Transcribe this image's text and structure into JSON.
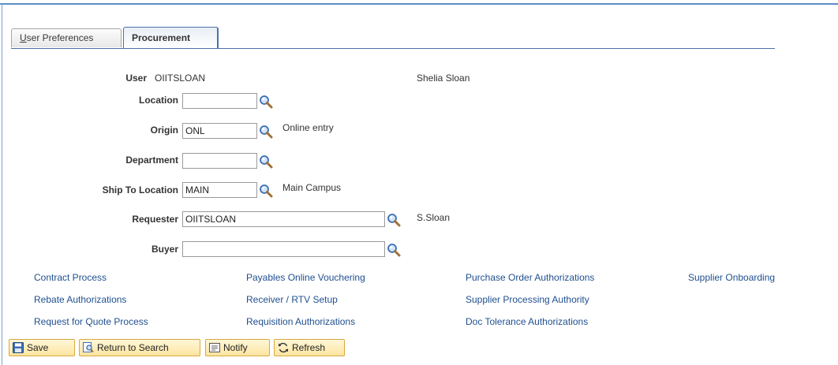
{
  "tabs": [
    {
      "label_accel": "U",
      "label_rest": "ser Preferences",
      "active": false
    },
    {
      "label": "Procurement",
      "active": true
    }
  ],
  "form": {
    "user": {
      "label": "User",
      "value": "OIITSLOAN",
      "description": "Shelia Sloan"
    },
    "location": {
      "label": "Location",
      "value": ""
    },
    "origin": {
      "label": "Origin",
      "value": "ONL",
      "description": "Online entry"
    },
    "department": {
      "label": "Department",
      "value": ""
    },
    "ship_to": {
      "label": "Ship To Location",
      "value": "MAIN",
      "description": "Main Campus"
    },
    "requester": {
      "label": "Requester",
      "value": "OIITSLOAN",
      "description": "S.Sloan"
    },
    "buyer": {
      "label": "Buyer",
      "value": ""
    }
  },
  "links": [
    "Contract Process",
    "Payables Online Vouchering",
    "Purchase Order Authorizations",
    "Supplier Onboarding",
    "Rebate Authorizations",
    "Receiver / RTV Setup",
    "Supplier Processing Authority",
    "Request for Quote Process",
    "Requisition Authorizations",
    "Doc Tolerance Authorizations"
  ],
  "toolbar": {
    "save": "Save",
    "return_to_search": "Return to Search",
    "notify": "Notify",
    "refresh": "Refresh"
  },
  "icons": {
    "lookup": "magnifier-icon",
    "save": "floppy-disk-icon",
    "return": "search-page-return-icon",
    "notify": "note-icon",
    "refresh": "circular-arrows-icon"
  },
  "colors": {
    "link": "#1f4f8f",
    "tab_border": "#4a72a8",
    "button_bg": "#fde5a0",
    "button_border": "#d8a93e"
  }
}
